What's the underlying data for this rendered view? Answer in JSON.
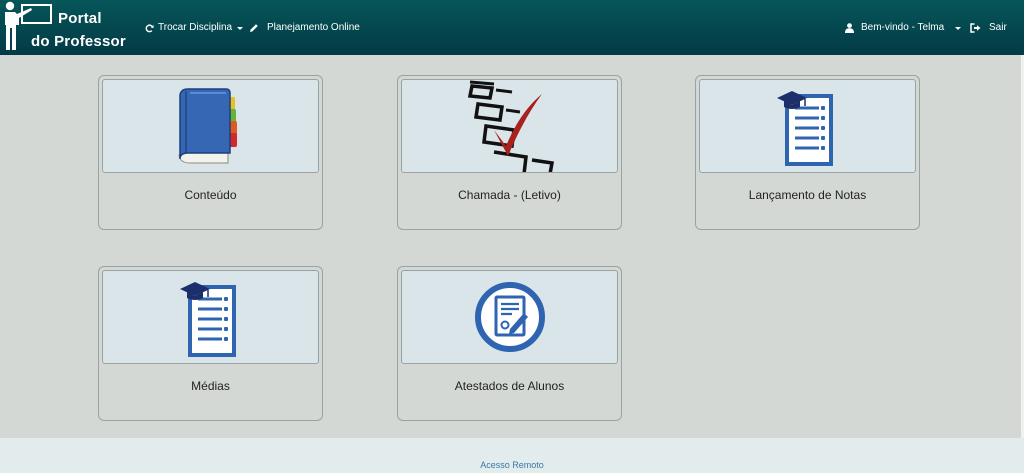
{
  "brand": {
    "line1": "Portal",
    "line2": "do Professor"
  },
  "nav": {
    "trocar_disciplina": "Trocar Disciplina",
    "planejamento_online": "Planejamento Online",
    "user_greeting": "Bem-vindo - Telma",
    "sair": "Sair"
  },
  "tiles": [
    {
      "label": "Conteúdo",
      "icon": "book-icon"
    },
    {
      "label": "Chamada - (Letivo)",
      "icon": "checklist-icon"
    },
    {
      "label": "Lançamento de Notas",
      "icon": "grades-list-icon"
    },
    {
      "label": "Médias",
      "icon": "grades-list-icon"
    },
    {
      "label": "Atestados de Alunos",
      "icon": "certificate-icon"
    }
  ],
  "footer": {
    "link": "Acesso Remoto"
  },
  "colors": {
    "navbar": "#04484f",
    "tile_bg": "#d9e5e8",
    "accent_blue": "#2e64b0",
    "check_red": "#a8201f",
    "footer_link": "#3a78a8"
  }
}
